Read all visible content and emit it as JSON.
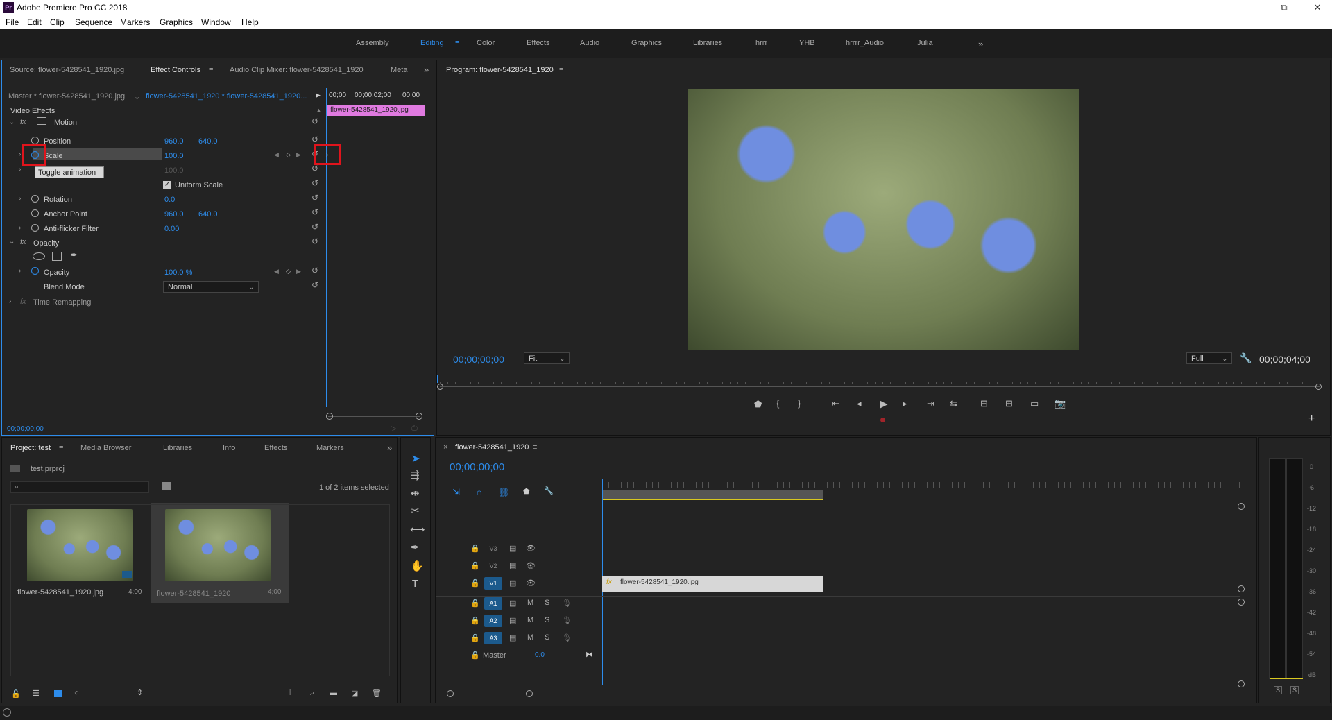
{
  "app": {
    "title": "Adobe Premiere Pro CC 2018",
    "logo": "Pr"
  },
  "window_controls": {
    "minimize": "—",
    "maximize": "⧉",
    "close": "✕"
  },
  "menu": [
    "File",
    "Edit",
    "Clip",
    "Sequence",
    "Markers",
    "Graphics",
    "Window",
    "Help"
  ],
  "workspaces": [
    "Assembly",
    "Editing",
    "Color",
    "Effects",
    "Audio",
    "Graphics",
    "Libraries",
    "hrrr",
    "YHB",
    "hrrrr_Audio",
    "Julia"
  ],
  "workspaces_active": "Editing",
  "workspaces_more": "»",
  "source_panel": {
    "tabs": [
      "Source: flower-5428541_1920.jpg",
      "Effect Controls",
      "Audio Clip Mixer: flower-5428541_1920",
      "Meta"
    ],
    "master_label": "Master * flower-5428541_1920.jpg",
    "sequence_label": "flower-5428541_1920 * flower-5428541_1920...",
    "timeline_times": [
      "00;00",
      "00;00;02;00",
      "00;00"
    ],
    "clip_label": "flower-5428541_1920.jpg",
    "video_effects": "Video Effects",
    "motion": "Motion",
    "position": {
      "label": "Position",
      "x": "960.0",
      "y": "640.0"
    },
    "scale": {
      "label": "Scale",
      "value": "100.0"
    },
    "scale_width_value": "100.0",
    "tooltip": "Toggle animation",
    "uniform_scale": "Uniform Scale",
    "rotation": {
      "label": "Rotation",
      "value": "0.0"
    },
    "anchor": {
      "label": "Anchor Point",
      "x": "960.0",
      "y": "640.0"
    },
    "antiflicker": {
      "label": "Anti-flicker Filter",
      "value": "0.00"
    },
    "opacity_group": "Opacity",
    "opacity": {
      "label": "Opacity",
      "value": "100.0 %"
    },
    "blend": {
      "label": "Blend Mode",
      "value": "Normal"
    },
    "time_remap": "Time Remapping",
    "timecode": "00;00;00;00"
  },
  "program_panel": {
    "title": "Program: flower-5428541_1920",
    "timecode": "00;00;00;00",
    "fit": "Fit",
    "quality": "Full",
    "duration": "00;00;04;00"
  },
  "project_panel": {
    "tabs": [
      "Project: test",
      "Media Browser",
      "Libraries",
      "Info",
      "Effects",
      "Markers"
    ],
    "file": "test.prproj",
    "selection": "1 of 2 items selected",
    "items": [
      {
        "name": "flower-5428541_1920.jpg",
        "duration": "4;00"
      },
      {
        "name": "flower-5428541_1920",
        "duration": "4;00"
      }
    ]
  },
  "timeline_panel": {
    "title": "flower-5428541_1920",
    "timecode": "00;00;00;00",
    "tracks_video": [
      "V3",
      "V2",
      "V1"
    ],
    "tracks_audio": [
      "A1",
      "A2",
      "A3"
    ],
    "master": "Master",
    "master_value": "0.0",
    "clip": "flower-5428541_1920.jpg",
    "m": "M",
    "s": "S"
  },
  "meter": {
    "labels": [
      "0",
      "-6",
      "-12",
      "-18",
      "-24",
      "-30",
      "-36",
      "-42",
      "-48",
      "-54",
      "dB"
    ],
    "solo": [
      "S",
      "S"
    ]
  },
  "icons": {
    "stopwatch": "stopwatch-icon",
    "reset": "reset-icon",
    "wrench": "wrench-icon",
    "camera": "camera-icon"
  },
  "colors": {
    "accent": "#2d8ceb",
    "clip_pink": "#e07ae0",
    "highlight_red": "#e0141c"
  }
}
